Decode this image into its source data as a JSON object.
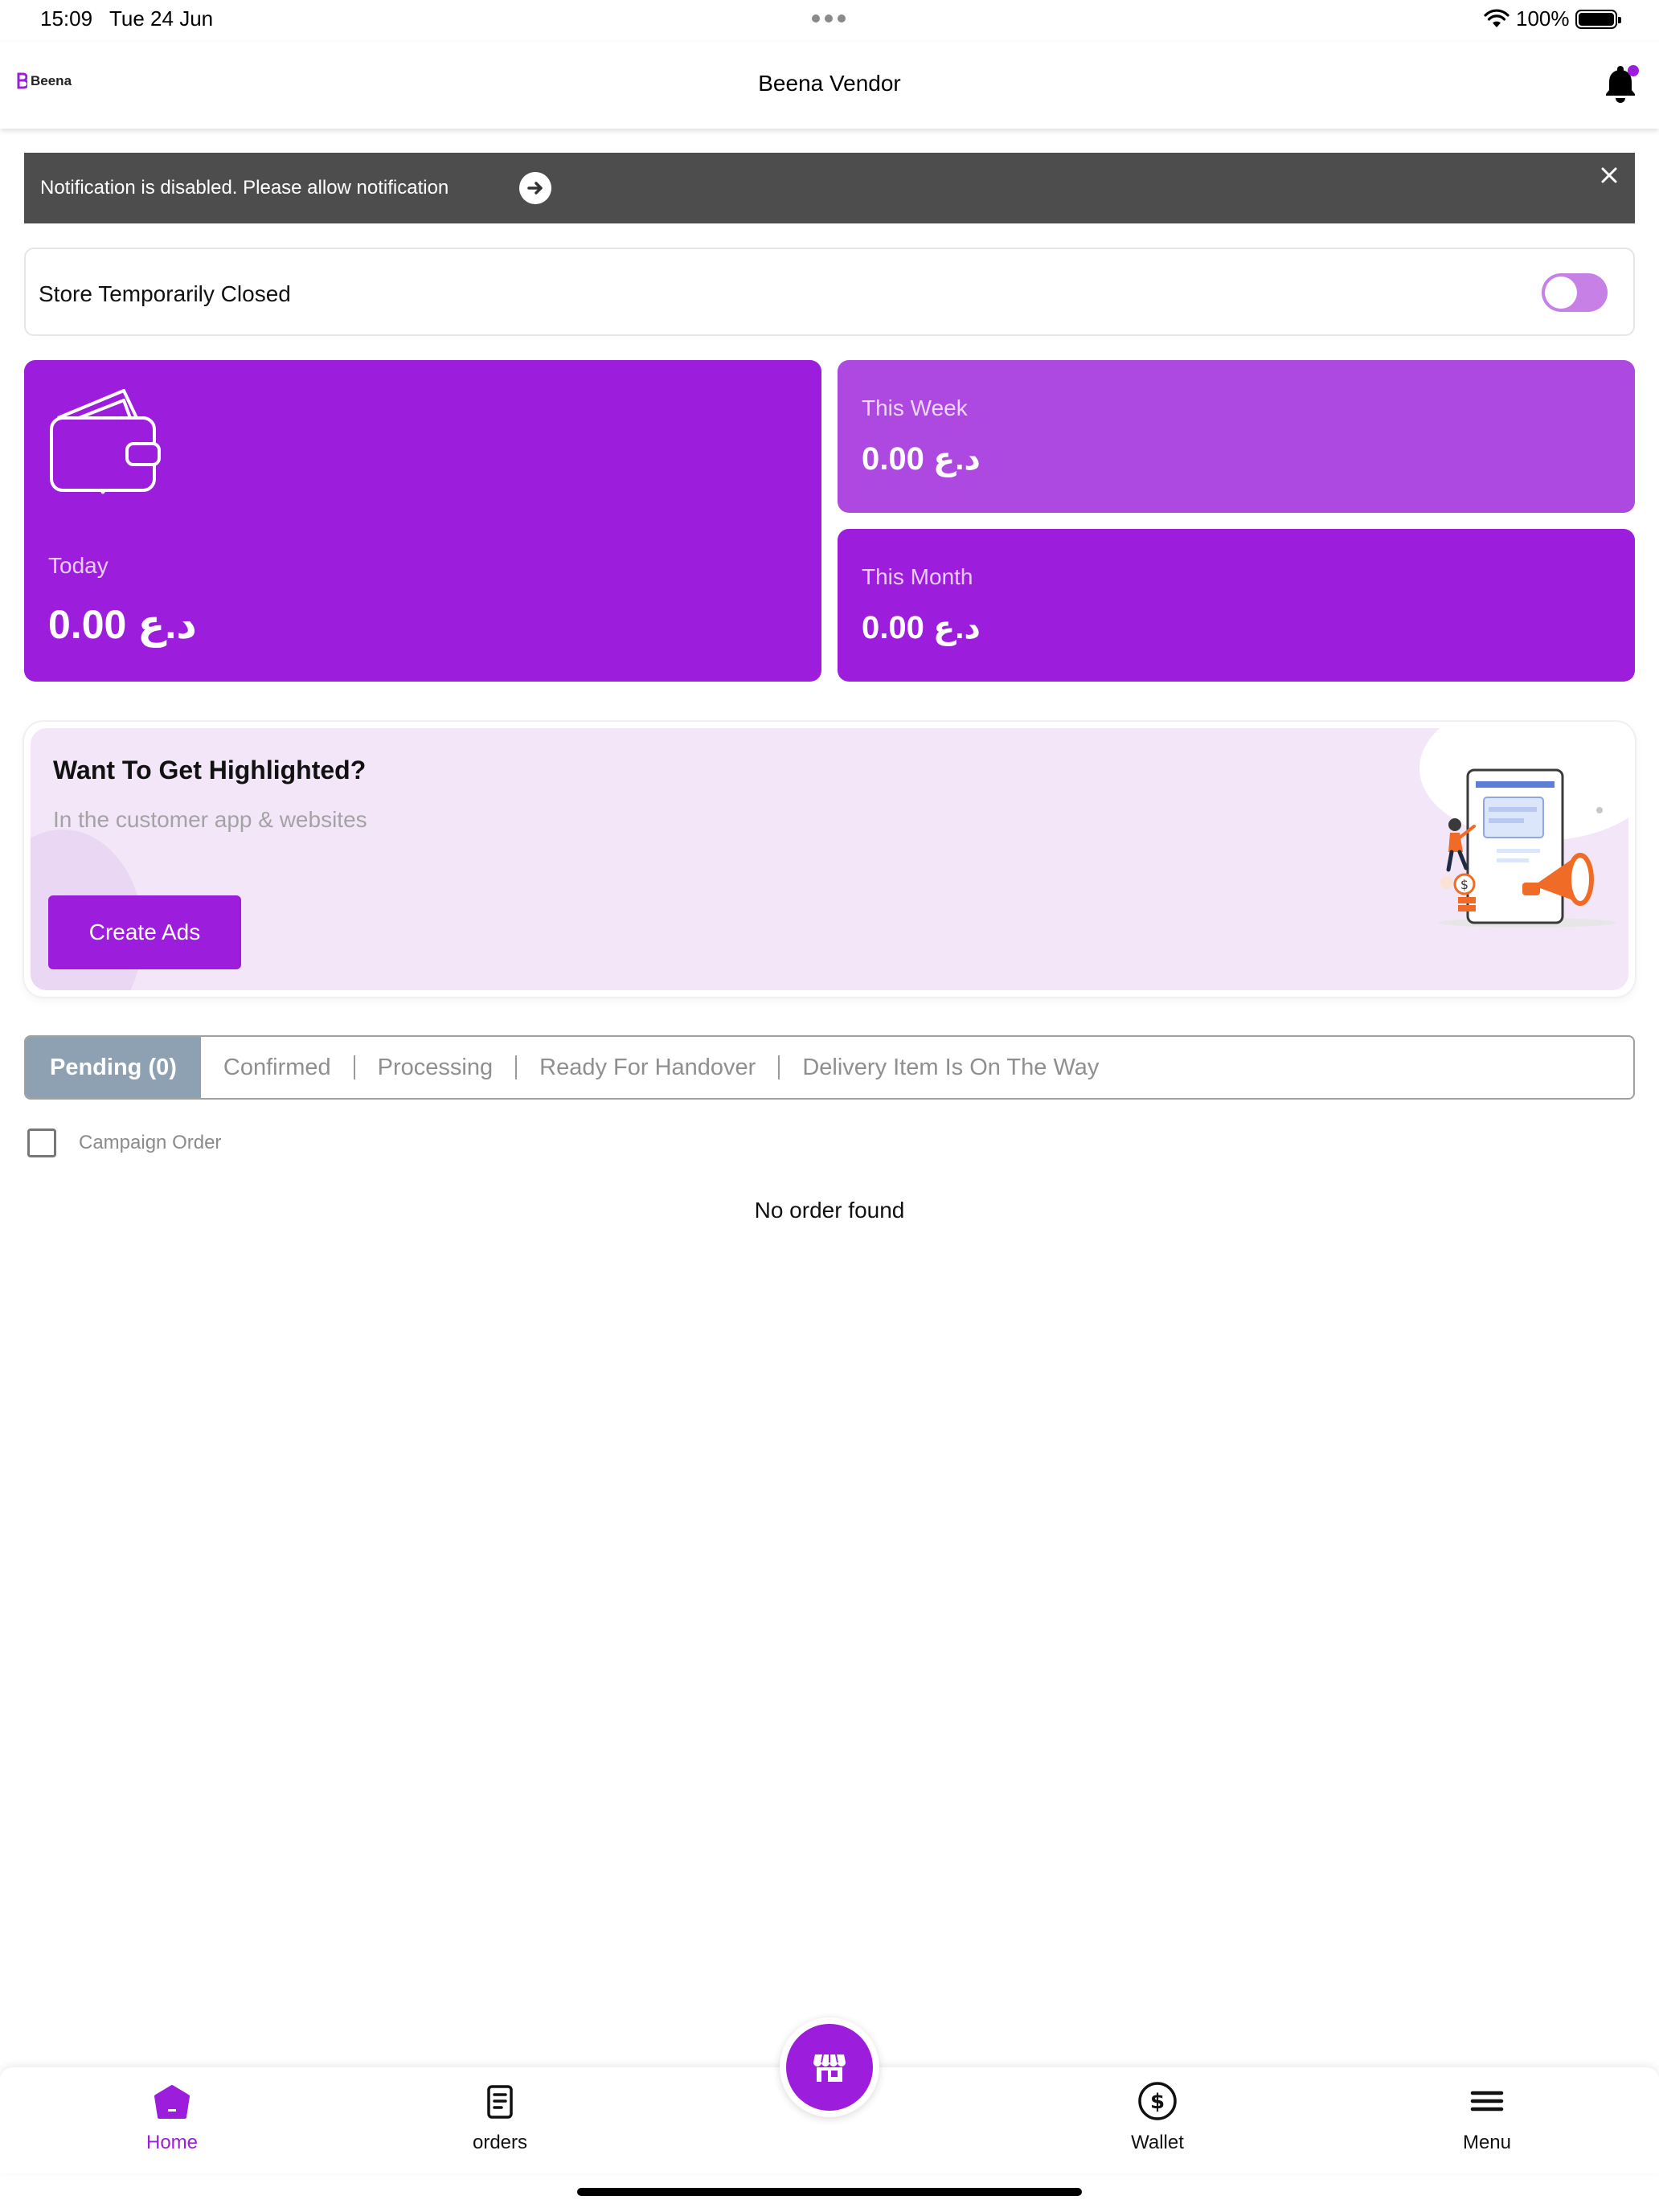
{
  "status_bar": {
    "time": "15:09",
    "date": "Tue 24 Jun",
    "battery": "100%"
  },
  "app_bar": {
    "logo_text": "Beena",
    "title": "Beena Vendor",
    "bell_icon": "bell-icon"
  },
  "notification_banner": {
    "text": "Notification is disabled. Please allow notification",
    "arrow_icon": "arrow-right-icon",
    "close_icon": "close-icon"
  },
  "store_status": {
    "label": "Store Temporarily Closed",
    "toggle_on": false
  },
  "earnings": {
    "today": {
      "label": "Today",
      "value": "0.00 د.ع"
    },
    "week": {
      "label": "This Week",
      "value": "0.00 د.ع"
    },
    "month": {
      "label": "This Month",
      "value": "0.00 د.ع"
    }
  },
  "ads": {
    "title": "Want To Get Highlighted?",
    "subtitle": "In the customer app & websites",
    "button": "Create Ads"
  },
  "order_tabs": [
    {
      "label": "Pending (0)",
      "active": true
    },
    {
      "label": "Confirmed",
      "active": false
    },
    {
      "label": "Processing",
      "active": false
    },
    {
      "label": "Ready For Handover",
      "active": false
    },
    {
      "label": "Delivery Item Is On The Way",
      "active": false
    }
  ],
  "campaign": {
    "label": "Campaign Order",
    "checked": false
  },
  "empty_message": "No order found",
  "bottom_nav": {
    "home": "Home",
    "orders": "orders",
    "wallet": "Wallet",
    "menu": "Menu",
    "center_icon": "store-icon"
  },
  "colors": {
    "brand": "#9c1ddc",
    "brand_light": "#ad48e1",
    "banner_bg": "#4d4d4d",
    "tab_active": "#8da1b3"
  }
}
